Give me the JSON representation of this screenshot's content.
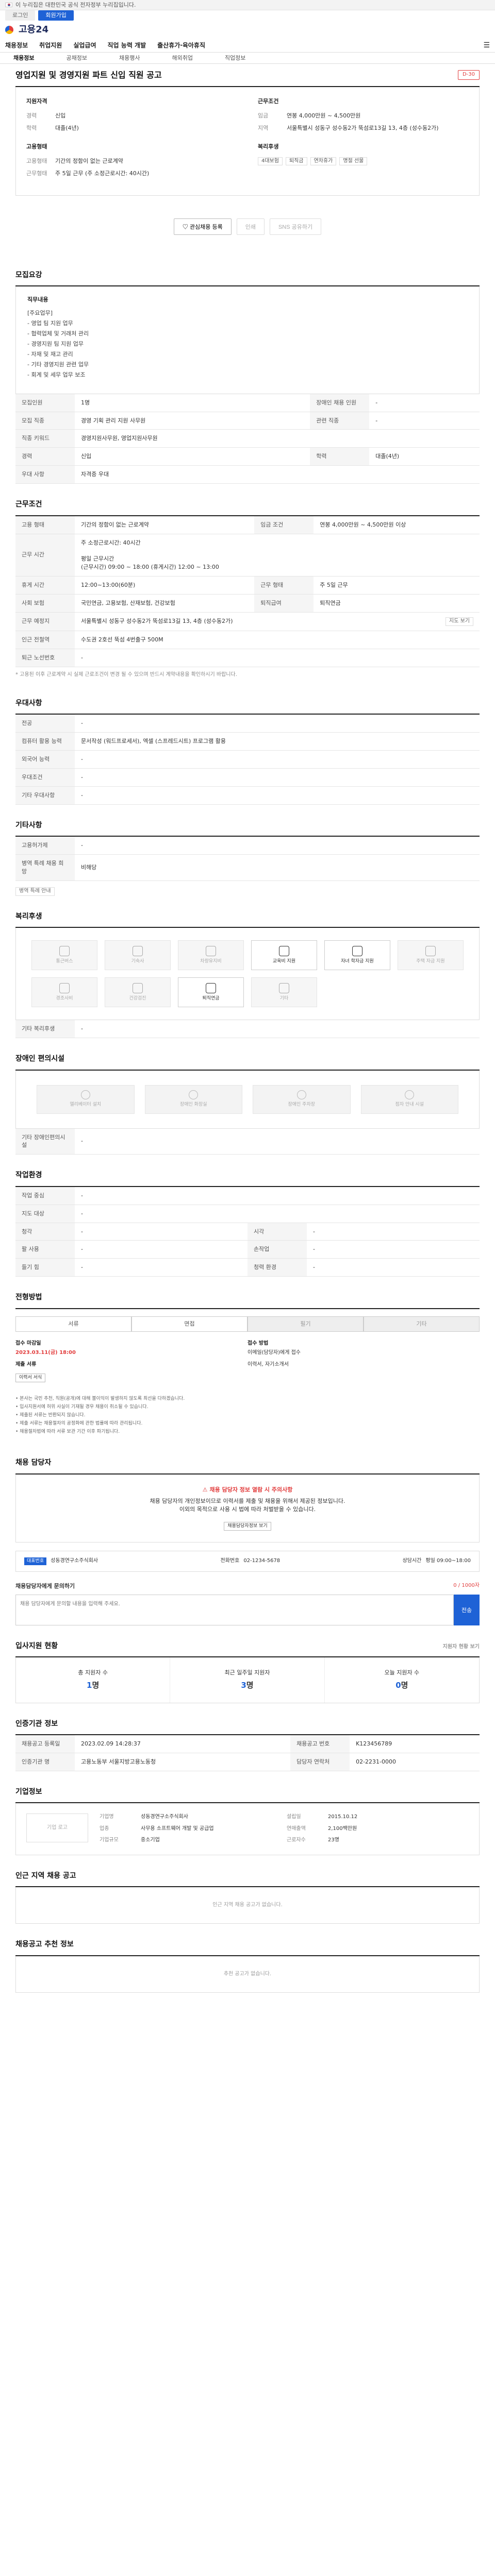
{
  "gov_bar": {
    "text": "이 누리집은 대한민국 공식 전자정부 누리집입니다."
  },
  "top_links": {
    "login": "로그인",
    "join": "회원가입"
  },
  "logo": {
    "text": "고용24"
  },
  "gnb": {
    "items": [
      "채용정보",
      "취업지원",
      "실업급여",
      "직업 능력 개발",
      "출산휴가·육아휴직"
    ]
  },
  "subnav": {
    "items": [
      "채용정보",
      "공채정보",
      "채용행사",
      "해외취업",
      "직업정보"
    ]
  },
  "job": {
    "title": "영업지원 및 경영지원 파트 신입 직원 공고",
    "d_day": "D-30",
    "company_label": "지원자격",
    "qual_heading": "지원자격",
    "qual_rows": [
      {
        "k": "경력",
        "v": "신입"
      },
      {
        "k": "학력",
        "v": "대졸(4년)"
      }
    ],
    "work_heading": "근무조건",
    "work_rows": [
      {
        "k": "임금",
        "v": "연봉 4,000만원 ~ 4,500만원"
      },
      {
        "k": "지역",
        "v": "서울특별시 성동구 성수동2가 뚝섬로13길 13, 4층 (성수동2가)"
      }
    ],
    "emp_heading": "고용형태",
    "emp_rows": [
      {
        "k": "고용형태",
        "v": "기간의 정함이 없는 근로계약"
      },
      {
        "k": "근무형태",
        "v": "주 5일 근무 (주 소정근로시간: 40시간)"
      }
    ],
    "welfare_heading": "복리후생",
    "welfare_tags": [
      "4대보험",
      "퇴직금",
      "연차휴가",
      "명절 선물"
    ]
  },
  "actions": {
    "scrap": "관심채용 등록",
    "print": "인쇄",
    "share": "SNS 공유하기"
  },
  "recruit": {
    "title": "모집요강",
    "job_title": "직무내용",
    "desc_lines": [
      "[주요업무]",
      "- 영업 팀 지원 업무",
      "- 협력업체 및 거래처 관리",
      "- 경영지원 팀 지원 업무",
      "- 자재 및 재고 관리",
      "- 기타 경영지원 관련 업무",
      "- 회계 및 세무 업무 보조"
    ]
  },
  "recruit_table": {
    "rows": [
      {
        "k": "모집인원",
        "v": "1명",
        "k2": "장애인 채용 인원",
        "v2": "-"
      },
      {
        "k": "모집 직종",
        "v": "경영 기획 관리 지원 사무원",
        "k2": "관련 직종",
        "v2": "-"
      },
      {
        "k": "직종 키워드",
        "v": "경영지원사무원, 영업지원사무원",
        "k2": "",
        "v2": ""
      },
      {
        "k": "경력",
        "v": "신입",
        "k2": "학력",
        "v2": "대졸(4년)"
      },
      {
        "k": "우대 사항",
        "v": "자격증 우대",
        "k2": "",
        "v2": ""
      }
    ]
  },
  "conditions": {
    "title": "근무조건",
    "rows": [
      {
        "k": "고용 형태",
        "v": "기간의 정함이 없는 근로계약",
        "k2": "임금 조건",
        "v2": "연봉 4,000만원 ~ 4,500만원 이상"
      },
      {
        "k": "근무 시간",
        "v": "주 소정근로시간: 40시간\n\n평일 근무시간\n(근무시간) 09:00 ~ 18:00 (휴게시간) 12:00 ~ 13:00",
        "k2": "",
        "v2": ""
      },
      {
        "k": "휴게 시간",
        "v": "12:00~13:00(60분)",
        "k2": "근무 형태",
        "v2": "주 5일 근무"
      },
      {
        "k": "사회 보험",
        "v": "국민연금, 고용보험, 산재보험, 건강보험",
        "k2": "퇴직급여",
        "v2": "퇴직연금"
      },
      {
        "k": "근무 예정지",
        "v": "서울특별시 성동구 성수동2가 뚝섬로13길 13, 4층 (성수동2가)",
        "k2": "",
        "v2": ""
      },
      {
        "k": "인근 전철역",
        "v": "수도권 2호선 뚝섬 4번출구 500M",
        "k2": "",
        "v2": ""
      },
      {
        "k": "퇴근 노선번호",
        "v": "-",
        "k2": "",
        "v2": ""
      }
    ],
    "map_button": "지도 보기",
    "note": "* 고용된 이후 근로계약 시 실제 근로조건이 변경 될 수 있으며 반드시 계약내용을 확인하시기 바랍니다."
  },
  "preference": {
    "title": "우대사항",
    "rows": [
      {
        "k": "전공",
        "v": "-"
      },
      {
        "k": "컴퓨터 활용 능력",
        "v": "문서작성 (워드프로세서), 엑셀 (스프레드시트) 프로그램 활용"
      },
      {
        "k": "외국어 능력",
        "v": "-"
      },
      {
        "k": "우대조건",
        "v": "-"
      },
      {
        "k": "기타 우대사항",
        "v": "-"
      }
    ]
  },
  "others": {
    "title": "기타사항",
    "rows": [
      {
        "k": "고용허가제",
        "v": "-"
      },
      {
        "k": "병역 특례 채용 희망",
        "v": "비해당"
      }
    ],
    "extra_button": "병역 특례 안내"
  },
  "welfare": {
    "title": "복리후생",
    "items": [
      {
        "label": "통근버스",
        "on": false
      },
      {
        "label": "기숙사",
        "on": false
      },
      {
        "label": "차량유지비",
        "on": false
      },
      {
        "label": "교육비 지원",
        "on": true
      },
      {
        "label": "자녀 학자금 지원",
        "on": true
      },
      {
        "label": "주택 자금 지원",
        "on": false
      },
      {
        "label": "경조사비",
        "on": false
      },
      {
        "label": "건강검진",
        "on": false
      },
      {
        "label": "퇴직연금",
        "on": true
      },
      {
        "label": "기타",
        "on": false
      }
    ],
    "other_label": "기타 복리후생",
    "other_value": "-"
  },
  "facilities": {
    "title": "장애인 편의시설",
    "items": [
      "엘리베이터 설치",
      "장애인 화장실",
      "장애인 주차장",
      "점자 안내 시설"
    ],
    "other_label": "기타 장애인편의시설",
    "other_value": "-"
  },
  "workplace": {
    "title": "작업환경",
    "rows": [
      {
        "k": "작업 중심",
        "v": "-",
        "k2": "",
        "v2": ""
      },
      {
        "k": "지도 대상",
        "v": "-",
        "k2": "",
        "v2": ""
      },
      {
        "k": "청각",
        "v": "-",
        "k2": "시각",
        "v2": "-"
      },
      {
        "k": "팔 사용",
        "v": "-",
        "k2": "손작업",
        "v2": "-"
      },
      {
        "k": "들기 힘",
        "v": "-",
        "k2": "청력 환경",
        "v2": "-"
      }
    ]
  },
  "apply": {
    "title": "전형방법",
    "tabs": [
      "서류",
      "면접",
      "필기",
      "기타"
    ],
    "period_label": "접수 마감일",
    "deadline": "2023.03.11(금) 18:00",
    "method_label": "접수 방법",
    "method_value": "이메일(담당자)에게 접수",
    "docs_label": "제출 서류",
    "docs_value": "이력서, 자기소개서",
    "form_button": "이력서 서식",
    "notices": [
      "• 본사는 국민 추천, 직원(공개)에 대해 불이익이 발생하지 않도록 최선을 다하겠습니다.",
      "• 입사지원서에 허위 사실이 기재될 경우 채용이 취소될 수 있습니다.",
      "• 제출된 서류는 반환되지 않습니다.",
      "• 제출 서류는 채용절차의 공정화에 관한 법률에 따라 관리됩니다.",
      "• 채용절차법에 따라 서류 보관 기간 이후 파기됩니다."
    ]
  },
  "contact": {
    "title": "채용 담당자",
    "warn_title": "채용 담당자 정보 열람 시 주의사항",
    "warn_line1": "채용 담당자의 개인정보이므로 이력서를 제출 및 채용을 위해서 제공된 정보입니다.",
    "warn_line2": "이외의 목적으로 사용 시 법에 따라 처벌받을 수 있습니다.",
    "open_button": "채용담당자정보 보기",
    "badge": "대표번호",
    "company_name": "성동경연구소주식회사",
    "phone_label": "전화번호",
    "phone_value": "02-1234-5678",
    "hours_label": "상담시간",
    "hours_value": "평일 09:00~18:00",
    "inquiry_title": "채용담당자에게 문의하기",
    "inquiry_count": "0 / 1000자",
    "inquiry_placeholder": "채용 담당자에게 문의할 내용을 입력해 주세요.",
    "inquiry_send": "전송"
  },
  "stats": {
    "title": "입사지원 현황",
    "side": "지원자 현황 보기",
    "cells": [
      {
        "label": "총 지원자 수",
        "value": "1",
        "unit": "명"
      },
      {
        "label": "최근 일주일 지원자",
        "value": "3",
        "unit": "명"
      },
      {
        "label": "오늘 지원자 수",
        "value": "0",
        "unit": "명"
      }
    ]
  },
  "manage": {
    "title": "인증기관 정보",
    "rows": [
      {
        "k": "채용공고 등록일",
        "v": "2023.02.09 14:28:37",
        "k2": "채용공고 번호",
        "v2": "K123456789"
      },
      {
        "k": "인증기관 명",
        "v": "고용노동부 서울지방고용노동청",
        "k2": "담당자 연락처",
        "v2": "02-2231-0000"
      }
    ]
  },
  "company": {
    "title": "기업정보",
    "logo_alt": "기업 로고",
    "name_k": "기업명",
    "name_v": "성동경연구소주식회사",
    "ind_k": "업종",
    "ind_v": "사무용 소프트웨어 개발 및 공급업",
    "size_k": "기업규모",
    "size_v": "중소기업",
    "found_k": "설립일",
    "found_v": "2015.10.12",
    "sales_k": "연매출액",
    "sales_v": "2,100백만원",
    "emp_k": "근로자수",
    "emp_v": "23명"
  },
  "similar": {
    "title": "인근 지역 채용 공고",
    "empty": "인근 지역 채용 공고가 없습니다."
  },
  "recommend": {
    "title": "채용공고 추천 정보",
    "empty": "추천 공고가 없습니다."
  }
}
